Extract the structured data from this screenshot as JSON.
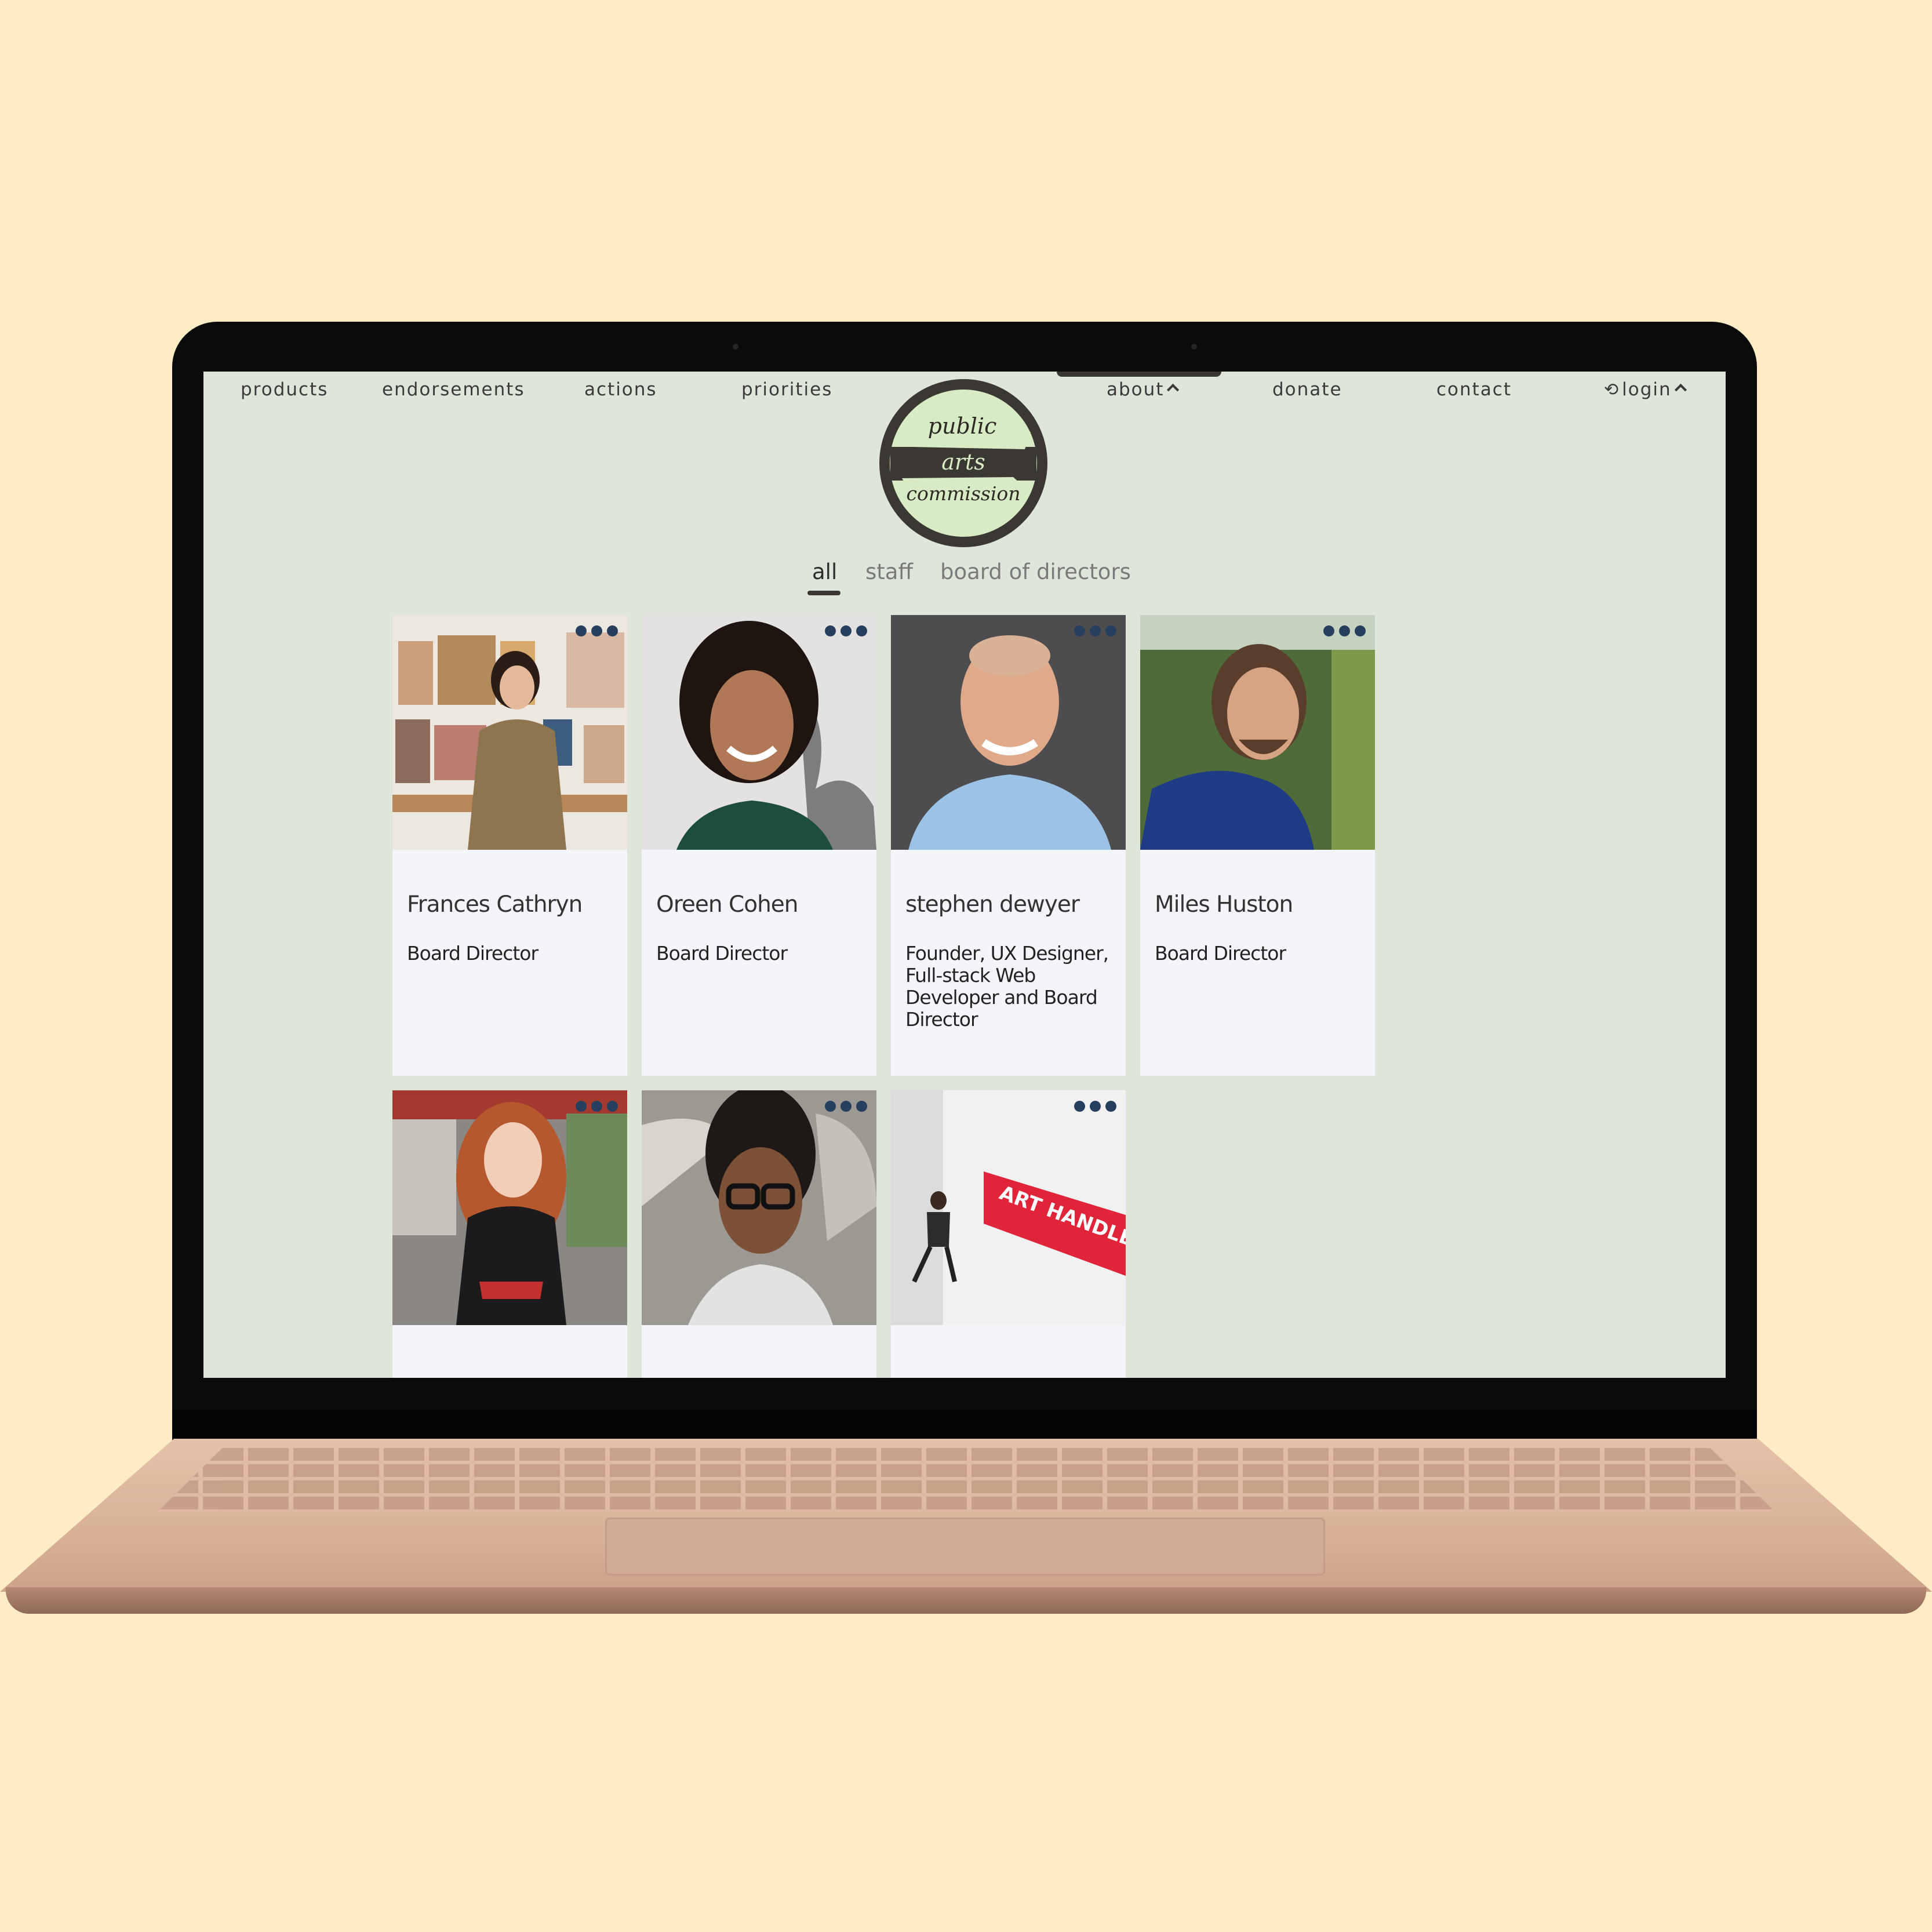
{
  "nav": {
    "left": [
      "products",
      "endorsements",
      "actions",
      "priorities"
    ],
    "right": [
      "about",
      "donate",
      "contact",
      "login"
    ]
  },
  "logo": {
    "line1": "public",
    "line2": "arts",
    "line3": "commission"
  },
  "filters": [
    "all",
    "staff",
    "board of directors"
  ],
  "active_filter": "all",
  "people": [
    {
      "name": "Frances Cathryn",
      "role": "Board Director",
      "photo": "woman-in-gallery-photo"
    },
    {
      "name": "Oreen Cohen",
      "role": "Board Director",
      "photo": "smiling-woman-curly-hair-photo"
    },
    {
      "name": "stephen dewyer",
      "role": "Founder, UX Designer, Full-stack Web Developer and Board Director",
      "photo": "smiling-man-blue-shirt-photo"
    },
    {
      "name": "Miles Huston",
      "role": "Board Director",
      "photo": "man-in-field-photo"
    },
    {
      "name": "",
      "role": "",
      "photo": "woman-red-hair-street-photo"
    },
    {
      "name": "",
      "role": "",
      "photo": "woman-glasses-braids-photo"
    },
    {
      "name": "",
      "role": "",
      "photo": "art-handler-banner-photo"
    }
  ],
  "banner_text": "ART HANDLER",
  "colors": {
    "page_bg": "#fdecc4",
    "screen_bg": "#dde6d8",
    "card_bg": "#f3f5fa",
    "logo_ring": "#3b3833",
    "logo_fill": "#d7ecc4",
    "menu_dots": "#263f5e"
  }
}
